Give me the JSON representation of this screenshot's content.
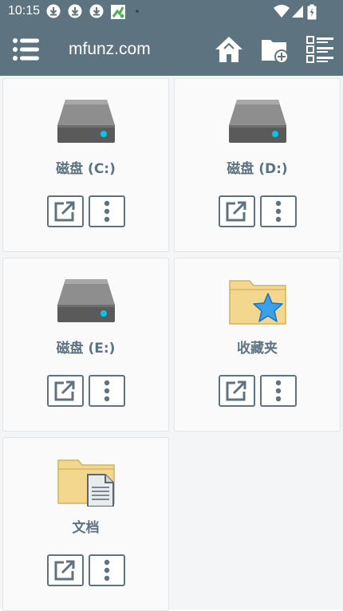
{
  "status_bar": {
    "time": "10:15",
    "icons": [
      "download-icon",
      "download-icon",
      "download-icon",
      "android-icon",
      "dot-icon",
      "wifi-icon",
      "signal-icon",
      "battery-charging-icon"
    ]
  },
  "app_bar": {
    "menu_icon": "menu-icon",
    "title": "mfunz.com",
    "actions": [
      "home-icon",
      "new-folder-icon",
      "list-view-icon"
    ]
  },
  "items": [
    {
      "label": "磁盘 (C:)",
      "icon": "drive-icon"
    },
    {
      "label": "磁盘 (D:)",
      "icon": "drive-icon"
    },
    {
      "label": "磁盘 (E:)",
      "icon": "drive-icon"
    },
    {
      "label": "收藏夹",
      "icon": "favorites-folder-icon"
    },
    {
      "label": "文档",
      "icon": "documents-folder-icon"
    }
  ],
  "colors": {
    "app_bar": "#5d7480",
    "accent": "#5d7480",
    "card_background": "#fafafa",
    "drive_light": "#00c8e8",
    "folder": "#f3d78e",
    "star": "#3aa0e8"
  }
}
